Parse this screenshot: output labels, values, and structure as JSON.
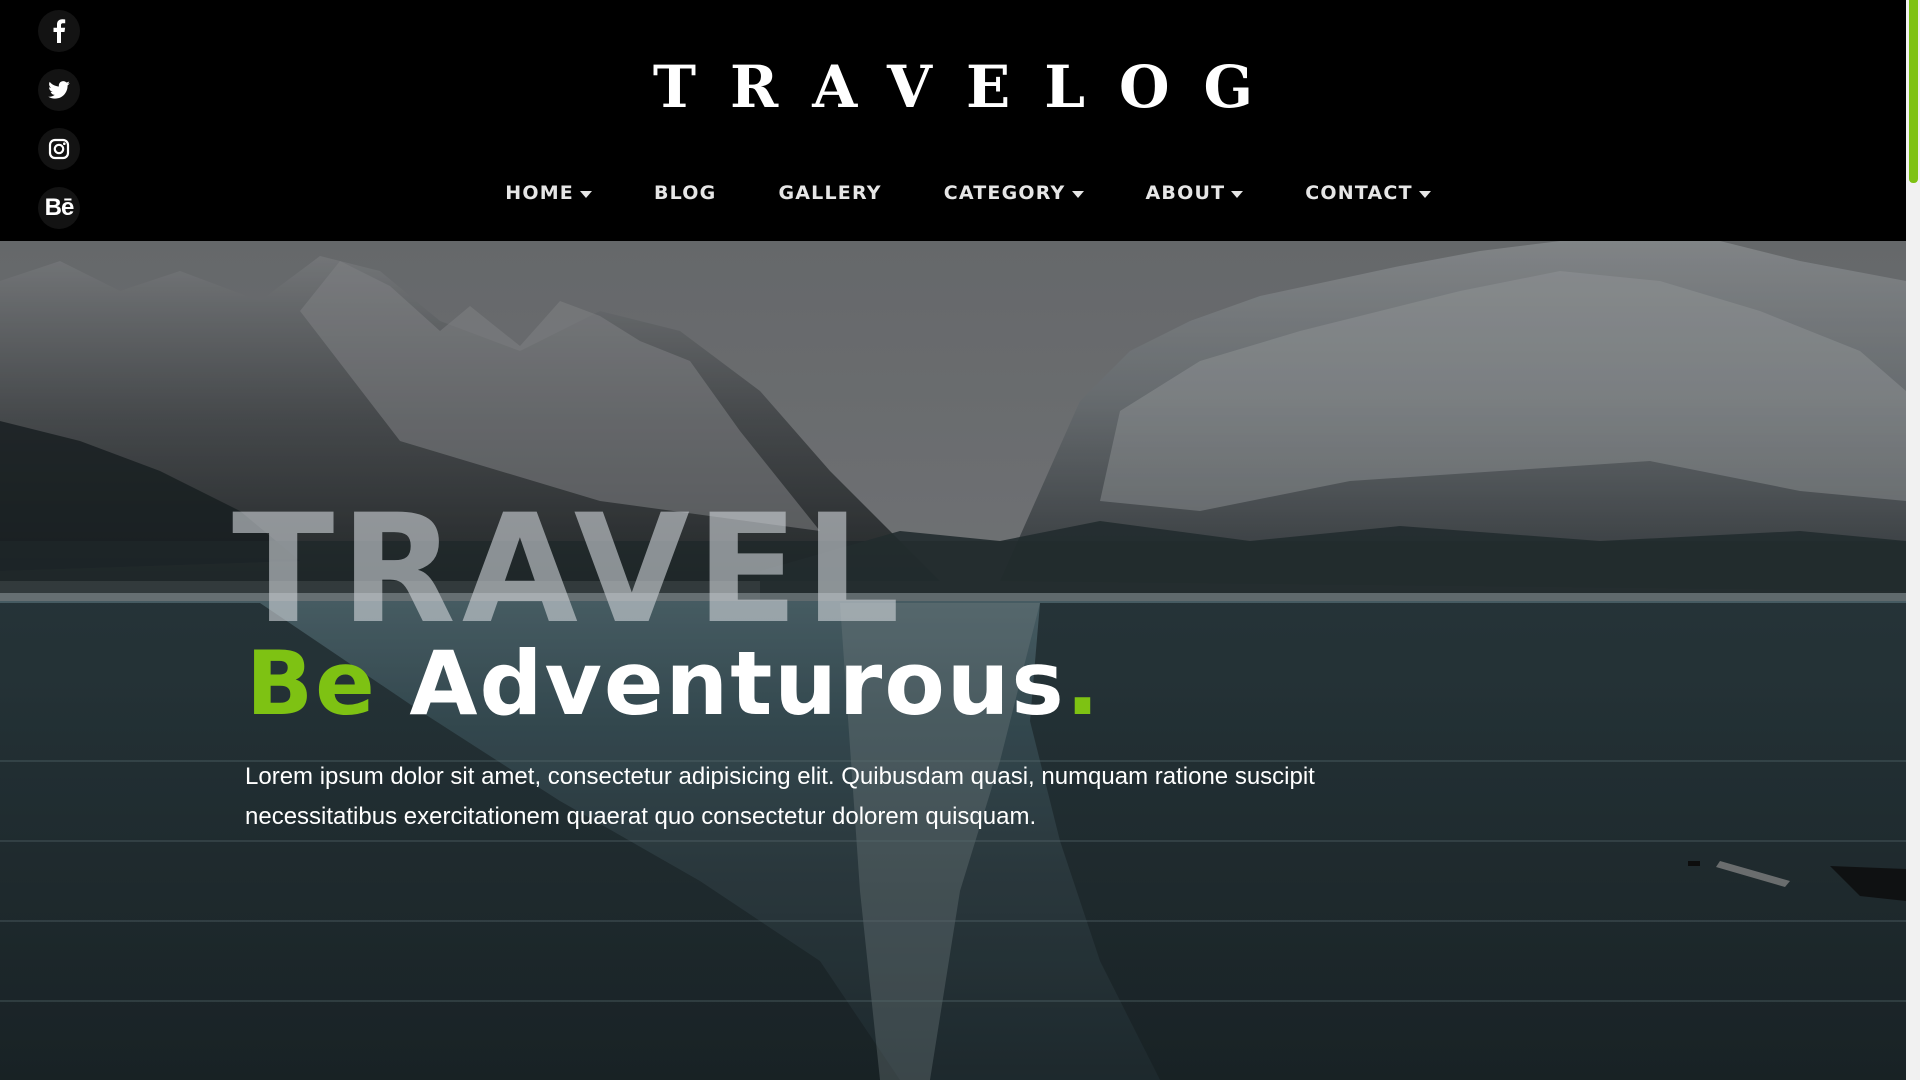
{
  "brand": {
    "title": "TRAVELOG"
  },
  "social": {
    "items": [
      {
        "icon": "facebook-icon",
        "label": "f"
      },
      {
        "icon": "twitter-icon",
        "label": ""
      },
      {
        "icon": "instagram-icon",
        "label": ""
      },
      {
        "icon": "behance-icon",
        "label": "Bē"
      }
    ]
  },
  "nav": {
    "items": [
      {
        "label": "HOME",
        "dropdown": true
      },
      {
        "label": "BLOG",
        "dropdown": false
      },
      {
        "label": "GALLERY",
        "dropdown": false
      },
      {
        "label": "CATEGORY",
        "dropdown": true
      },
      {
        "label": "ABOUT",
        "dropdown": true
      },
      {
        "label": "CONTACT",
        "dropdown": true
      }
    ]
  },
  "hero": {
    "big_word": "TRAVEL",
    "headline_accent": "Be",
    "headline_main": "Adventurous",
    "headline_dot": ".",
    "paragraph": "Lorem ipsum dolor sit amet, consectetur adipisicing elit. Quibusdam quasi, numquam ratione suscipit necessitatibus exercitationem quaerat quo consectetur dolorem quisquam."
  },
  "colors": {
    "accent": "#7ec213",
    "header_bg": "#000000",
    "text": "#ffffff"
  }
}
